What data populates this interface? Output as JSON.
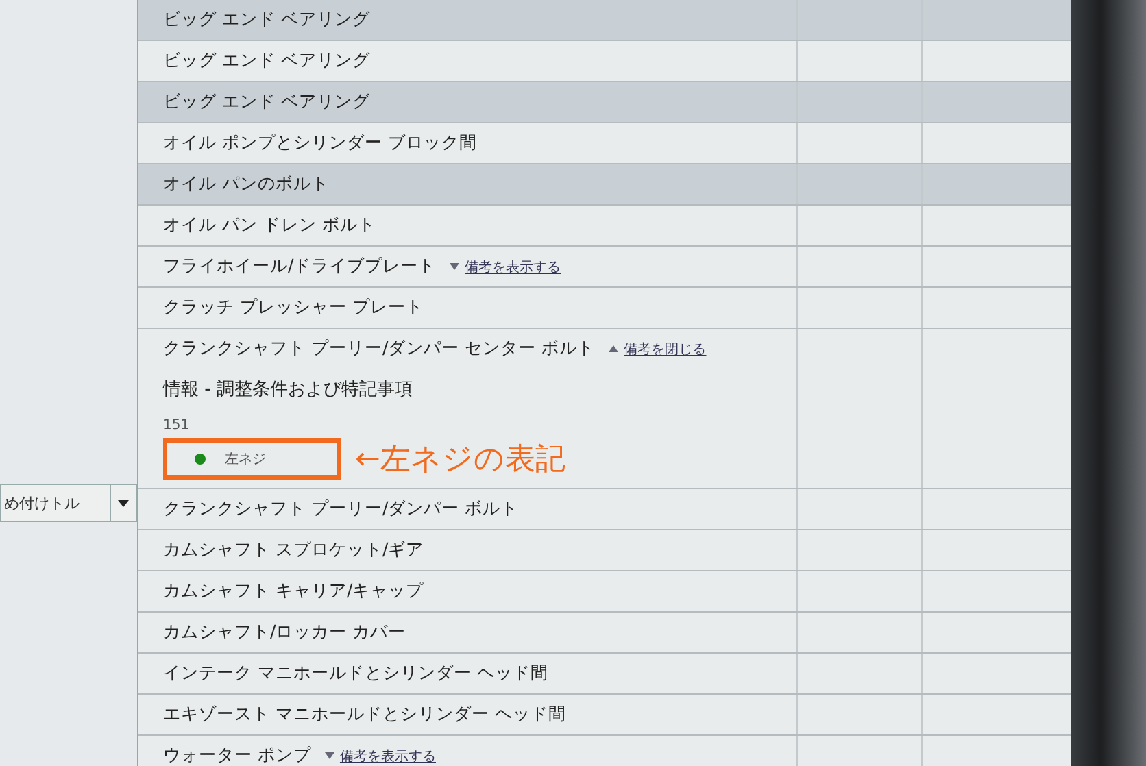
{
  "filter": {
    "value": "め付けトル"
  },
  "rows": [
    {
      "name": "ビッグ エンド ベアリング"
    },
    {
      "name": "ビッグ エンド ベアリング"
    },
    {
      "name": "ビッグ エンド ベアリング"
    },
    {
      "name": "オイル ポンプとシリンダー ブロック間"
    },
    {
      "name": "オイル パンのボルト"
    },
    {
      "name": "オイル パン ドレン ボルト"
    },
    {
      "name": "フライホイール/ドライブプレート",
      "note": {
        "label": "備考を表示する",
        "expanded": false
      }
    },
    {
      "name": "クラッチ プレッシャー プレート"
    },
    {
      "name": "クランクシャフト プーリー/ダンパー センター ボルト",
      "note": {
        "label": "備考を閉じる",
        "expanded": true
      },
      "info": {
        "title": "情報 - 調整条件および特記事項",
        "number": "151",
        "thread": "左ネジ",
        "color": "#1a8a1a",
        "annotation": "←左ネジの表記"
      }
    },
    {
      "name": "クランクシャフト プーリー/ダンパー ボルト"
    },
    {
      "name": "カムシャフト スプロケット/ギア"
    },
    {
      "name": "カムシャフト キャリア/キャップ"
    },
    {
      "name": "カムシャフト/ロッカー カバー"
    },
    {
      "name": "インテーク マニホールドとシリンダー ヘッド間"
    },
    {
      "name": "エキゾースト マニホールドとシリンダー ヘッド間"
    },
    {
      "name": "ウォーター ポンプ",
      "note": {
        "label": "備考を表示する",
        "expanded": false
      }
    }
  ]
}
